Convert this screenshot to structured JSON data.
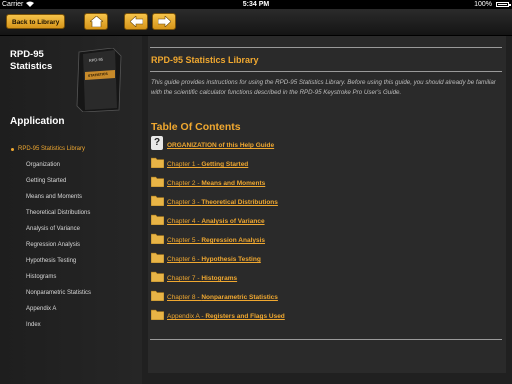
{
  "status_bar": {
    "carrier": "Carrier",
    "time": "5:34 PM",
    "battery": "100%"
  },
  "toolbar": {
    "back_label": "Back to Library"
  },
  "sidebar": {
    "title_line1": "RPD-95",
    "title_line2": "Statistics",
    "book_label": "RPD-95 STATISTICS",
    "section": "Application",
    "items": [
      {
        "label": "RPD-95 Statistics Library"
      },
      {
        "label": "Organization"
      },
      {
        "label": "Getting Started"
      },
      {
        "label": "Means and Moments"
      },
      {
        "label": "Theoretical Distributions"
      },
      {
        "label": "Analysis of Variance"
      },
      {
        "label": "Regression Analysis"
      },
      {
        "label": "Hypothesis Testing"
      },
      {
        "label": "Histograms"
      },
      {
        "label": "Nonparametric Statistics"
      },
      {
        "label": "Appendix A"
      },
      {
        "label": "Index"
      }
    ]
  },
  "main": {
    "title": "RPD-95 Statistics Library",
    "intro": "This guide provides instructions for using the RPD-95 Statistics Library. Before using this guide, you should already be familiar with the scientific calculator functions described in the RPD-95 Keystroke Pro User's Guide.",
    "toc_title": "Table Of Contents",
    "toc": [
      {
        "prefix": "",
        "link": "ORGANIZATION of this Help Guide",
        "icon": "help-icon"
      },
      {
        "prefix": "Chapter 1 - ",
        "link": "Getting Started",
        "icon": "folder-icon"
      },
      {
        "prefix": "Chapter 2 - ",
        "link": "Means and Moments",
        "icon": "folder-icon"
      },
      {
        "prefix": "Chapter 3 - ",
        "link": "Theoretical Distributions",
        "icon": "folder-icon"
      },
      {
        "prefix": "Chapter 4 - ",
        "link": "Analysis of Variance",
        "icon": "folder-icon"
      },
      {
        "prefix": "Chapter 5 - ",
        "link": "Regression Analysis",
        "icon": "folder-icon"
      },
      {
        "prefix": "Chapter 6 - ",
        "link": "Hypothesis Testing",
        "icon": "folder-icon"
      },
      {
        "prefix": "Chapter 7 - ",
        "link": "Histograms",
        "icon": "folder-icon"
      },
      {
        "prefix": "Chapter 8 - ",
        "link": "Nonparametric Statistics",
        "icon": "folder-icon"
      },
      {
        "prefix": "Appendix A - ",
        "link": "Registers and Flags Used",
        "icon": "folder-icon"
      }
    ]
  },
  "colors": {
    "accent": "#f0a830",
    "button": "#e8ad2c"
  }
}
